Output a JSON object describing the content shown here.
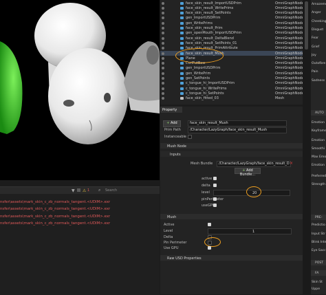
{
  "viewport": {},
  "console": {
    "search_placeholder": "Search",
    "counts": "1",
    "lines": [
      "nsfer\\assets\\mark_skin_c_zb_normals_tangent.<UDIM>.exr",
      "nsfer\\assets\\mark_skin_c_zb_normals_tangent.<UDIM>.exr",
      "nsfer\\assets\\mark_skin_c_zb_normals_tangent.<UDIM>.exr",
      "nsfer\\assets\\mark_skin_c_zb_normals_tangent.<UDIM>.exr"
    ]
  },
  "stage": {
    "rows": [
      {
        "name": "face_skin_result_ImportUSDPrim",
        "type": "OmniGraphNode"
      },
      {
        "name": "face_skin_result_WritePrims",
        "type": "OmniGraphNode"
      },
      {
        "name": "face_skin_result_SetPoints",
        "type": "OmniGraphNode"
      },
      {
        "name": "gen_ImportUSDPrim",
        "type": "OmniGraphNode"
      },
      {
        "name": "gen_WritePrims",
        "type": "OmniGraphNode"
      },
      {
        "name": "face_skin_result_Prim",
        "type": "OmniGraphNode"
      },
      {
        "name": "gen_openMouth_ImportUSDPrim",
        "type": "OmniGraphNode"
      },
      {
        "name": "face_skin_result_DeltaBlend",
        "type": "OmniGraphNode"
      },
      {
        "name": "face_skin_result_SetPoints_01",
        "type": "OmniGraphNode"
      },
      {
        "name": "face_skin_result_PrimAttribute",
        "type": "OmniGraphNode"
      },
      {
        "name": "face_skin_result_Mush",
        "type": "OmniGraphNode"
      },
      {
        "name": "Plane",
        "type": "OmniGraphNode"
      },
      {
        "name": "CurlFutBaw",
        "type": "OmniGraphNode"
      },
      {
        "name": "gen_ImportUSDPrim",
        "type": "OmniGraphNode"
      },
      {
        "name": "gen_WritePrim",
        "type": "OmniGraphNode"
      },
      {
        "name": "gen_SetPoints",
        "type": "OmniGraphNode"
      },
      {
        "name": "c_tongue_hi_ImportUSDPrim",
        "type": "OmniGraphNode"
      },
      {
        "name": "c_tongue_hi_WritePrims",
        "type": "OmniGraphNode"
      },
      {
        "name": "c_tongue_hi_SetPoints",
        "type": "OmniGraphNode"
      },
      {
        "name": "face_skin_fitted_03",
        "type": "Mesh"
      }
    ]
  },
  "property": {
    "tab": "Property",
    "add_label": "Add",
    "name_value": "face_skin_result_Mush",
    "prim_path_label": "Prim Path",
    "prim_path_value": "/Character/LazyGraph/face_skin_result_Mush",
    "instanceable_label": "Instanceable",
    "mush_node_header": "Mush Node",
    "inputs_header": "Inputs",
    "mesh_bundle_label": "Mesh Bundle",
    "mesh_bundle_value": "/Character/LazyGraph/face_skin_result_D",
    "add_bundle_label": "Add Bundle...",
    "inputs": [
      {
        "label": "active",
        "value": ""
      },
      {
        "label": "delta",
        "value": ""
      },
      {
        "label": "level",
        "value": "20"
      },
      {
        "label": "pinPerimeter",
        "value": ""
      },
      {
        "label": "useGPU",
        "value": ""
      }
    ],
    "mush_header": "Mush",
    "mush": [
      {
        "label": "Active",
        "value": ""
      },
      {
        "label": "Level",
        "value": "1"
      },
      {
        "label": "Delta",
        "value": ""
      },
      {
        "label": "Pin Perimeter",
        "value": ""
      },
      {
        "label": "Use GPU",
        "value": ""
      }
    ],
    "raw_usd_header": "Raw USD Properties"
  },
  "right_panel": {
    "labels_top": [
      "Amazeme",
      "Anger",
      "Cheeking",
      "Disgust",
      "Fear",
      "Grief",
      "Joy",
      "Outofbre",
      "Pain",
      "Sadness"
    ],
    "auto_header": "AUTO",
    "labels_mid": [
      "Emotion",
      "Keyframe",
      "Emotion",
      "Smoothi",
      "Max Emo",
      "Emotion",
      "Preferred",
      "Strength"
    ],
    "pre_header": "PRE-",
    "labels_low": [
      "Predictio",
      "Input Str",
      "Blink Inte",
      "Eye Sacci"
    ],
    "post_header": "POST",
    "fa_header": "FA",
    "labels_bottom": [
      "Skin St",
      "Uppe"
    ]
  }
}
